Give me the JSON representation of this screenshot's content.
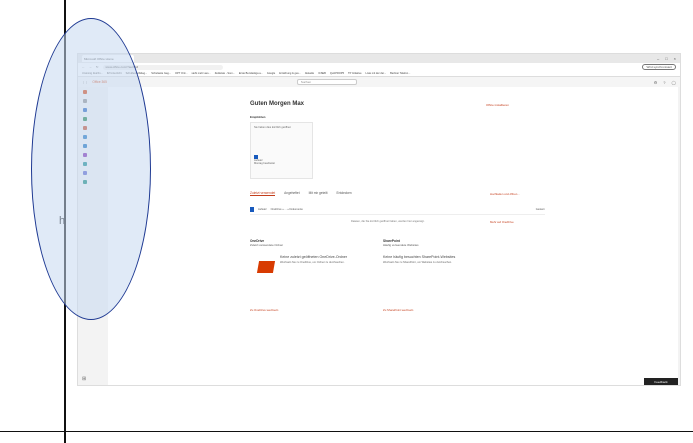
{
  "browser": {
    "tab_title": "Microsoft Office Home",
    "url": "www.office.com/?auth=2",
    "profile_button": "Wird synchronisiert",
    "bookmarks": [
      "Unsinnig Zeichn...",
      "IM Unterricht",
      "Schulbedarfsbeg...",
      "Schulseite Geg...",
      "OPT Ord...",
      "sieht mehr aus...",
      "Zeitleiste - Som...",
      "Erste Bundesliga a...",
      "Google",
      "Ernährung & ges...",
      "Aktuelle",
      "ICSEB",
      "QuizPROP5",
      "TP Initiative",
      "Liste mit der der...",
      "Berliner Telefon..."
    ]
  },
  "app": {
    "name": "Office 365",
    "search_placeholder": "Suchen"
  },
  "main": {
    "greeting": "Guten Morgen Max",
    "install_label": "Office installieren",
    "quick_start_label": "Empfohlen",
    "card_text": "Sie haben dies kürzlich geöffnet",
    "card_file": "Aufsatz",
    "card_sub": "Montag bearbeitet",
    "tabs": [
      "Zuletzt verwendet",
      "Angeheftet",
      "Mit mir geteilt",
      "Entdecken"
    ],
    "tab_right": "Hochladen und öffnen...",
    "file_name": "Aufsatz",
    "file_path": "OneDrive » ... » Dokumente",
    "file_date": "Gestern",
    "hint": "Dateien, die Sie kürzlich geöffnet haben, werden hier angezeigt.",
    "more_link": "Mehr auf OneDrive"
  },
  "onedrive": {
    "heading": "OneDrive",
    "sub": "Zuletzt verwendete Ordner",
    "promo_title": "Keine zuletzt geöffneten OneDrive-Ordner",
    "promo_text": "Wechseln Sie zu OneDrive, um Ordner zu durchsuchen.",
    "link": "Zu OneDrive wechseln"
  },
  "sharepoint": {
    "heading": "SharePoint",
    "sub": "Häufig verwendete Websites",
    "promo_title": "Keine häufig besuchten SharePoint-Websites",
    "promo_text": "Wechseln Sie zu SharePoint, um Websites zu durchsuchen.",
    "link": "Zu SharePoint wechseln"
  },
  "feedback_label": "Feedback",
  "colors": {
    "accent": "#c43e1c",
    "office": "#d83b01",
    "annotation": "#1f3a93"
  },
  "icons": [
    "home-icon",
    "add-icon",
    "word-icon",
    "excel-icon",
    "powerpoint-icon",
    "outlook-icon",
    "onedrive-icon",
    "onenote-icon",
    "sharepoint-icon",
    "teams-icon",
    "sway-icon",
    "waffle-icon"
  ],
  "margin_text": "h"
}
